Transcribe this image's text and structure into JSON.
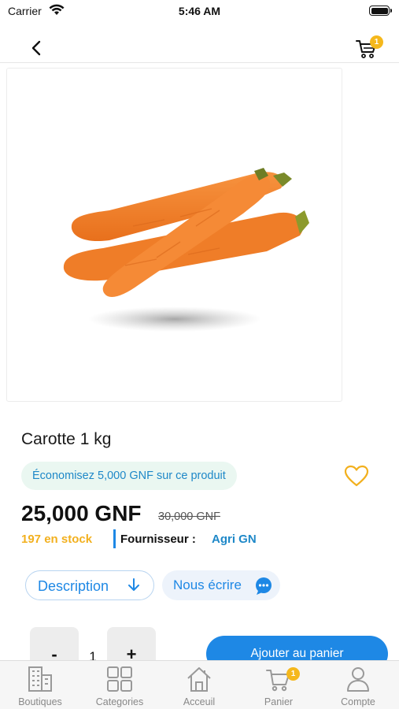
{
  "status_bar": {
    "carrier": "Carrier",
    "time": "5:46 AM"
  },
  "header": {
    "cart_count": "1"
  },
  "product": {
    "title": "Carotte 1 kg",
    "saving_text": "Économisez 5,000 GNF sur ce produit",
    "price": "25,000 GNF",
    "old_price": "30,000 GNF",
    "stock": "197 en stock",
    "supplier_label": "Fournisseur :",
    "supplier_name": "Agri GN"
  },
  "actions": {
    "description_label": "Description",
    "write_label": "Nous écrire",
    "qty_minus": "-",
    "qty_value": "1",
    "qty_plus": "+",
    "add_to_cart_label": "Ajouter au panier"
  },
  "tabbar": {
    "items": [
      {
        "label": "Boutiques",
        "icon": "buildings-icon"
      },
      {
        "label": "Categories",
        "icon": "grid-icon"
      },
      {
        "label": "Acceuil",
        "icon": "home-icon"
      },
      {
        "label": "Panier",
        "icon": "cart-icon",
        "badge": "1"
      },
      {
        "label": "Compte",
        "icon": "user-icon"
      }
    ]
  },
  "colors": {
    "accent": "#1e88e5",
    "badge": "#f5b81c",
    "stock": "#f2b01e",
    "saving_bg": "#eaf7f1"
  }
}
